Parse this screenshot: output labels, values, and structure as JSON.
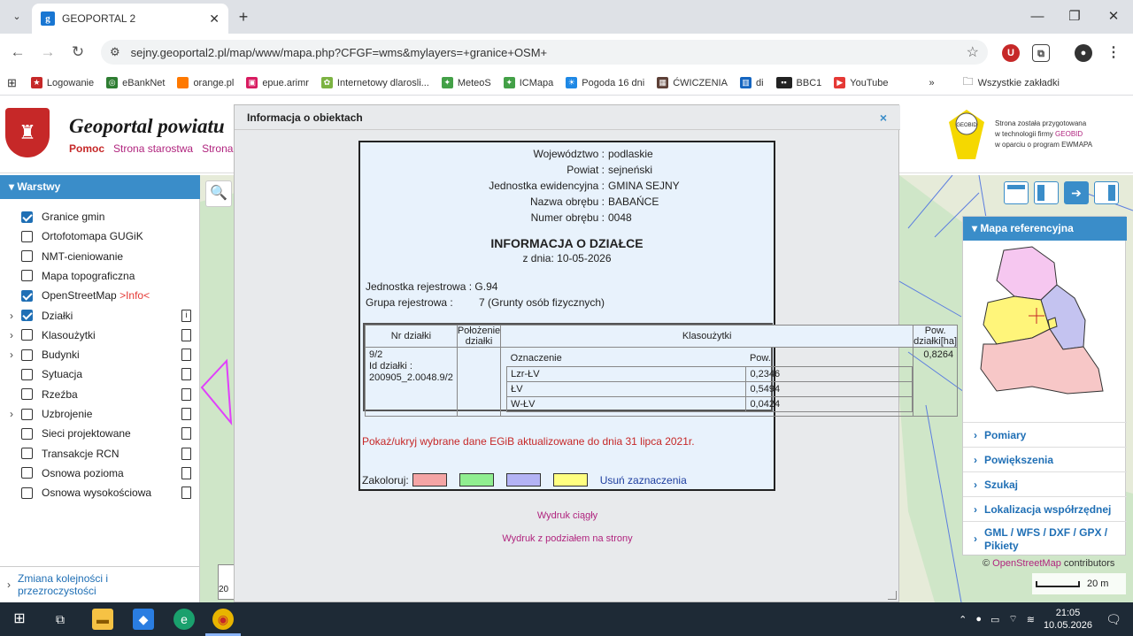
{
  "browser": {
    "tab_title": "GEOPORTAL 2",
    "url": "sejny.geoportal2.pl/map/www/mapa.php?CFGF=wms&mylayers=+granice+OSM+",
    "bookmarks": [
      "Logowanie",
      "eBankNet",
      "orange.pl",
      "epue.arimr",
      "Internetowy dlarosli...",
      "MeteoS",
      "ICMapa",
      "Pogoda 16 dni",
      "ĆWICZENIA",
      "di",
      "BBC1",
      "YouTube"
    ],
    "bookmarks_more": "»",
    "all_bookmarks": "Wszystkie zakładki"
  },
  "header": {
    "title": "Geoportal powiatu",
    "links": [
      "Pomoc",
      "Strona starostwa",
      "Strona"
    ],
    "geobid_line1": "Strona została przygotowana",
    "geobid_line2a": "w technologii firmy ",
    "geobid_brand": "GEOBID",
    "geobid_line3": "w oparciu o program EWMAPA",
    "geobid_logo": "GEOBID"
  },
  "layers_panel": {
    "title": "Warstwy",
    "items": [
      {
        "label": "Granice gmin",
        "checked": true,
        "expandable": false,
        "icon": ""
      },
      {
        "label": "Ortofotomapa GUGiK",
        "checked": false,
        "expandable": false,
        "icon": ""
      },
      {
        "label": "NMT-cieniowanie",
        "checked": false,
        "expandable": false,
        "icon": ""
      },
      {
        "label": "Mapa topograficzna",
        "checked": false,
        "expandable": false,
        "icon": ""
      },
      {
        "label": "OpenStreetMap",
        "suffix": ">Info<",
        "checked": true,
        "expandable": false,
        "icon": ""
      },
      {
        "label": "Działki",
        "checked": true,
        "expandable": true,
        "icon": "doc-info"
      },
      {
        "label": "Klasoużytki",
        "checked": false,
        "expandable": true,
        "icon": "doc"
      },
      {
        "label": "Budynki",
        "checked": false,
        "expandable": true,
        "icon": "doc"
      },
      {
        "label": "Sytuacja",
        "checked": false,
        "expandable": false,
        "icon": "doc"
      },
      {
        "label": "Rzeźba",
        "checked": false,
        "expandable": false,
        "icon": "doc"
      },
      {
        "label": "Uzbrojenie",
        "checked": false,
        "expandable": true,
        "icon": "doc"
      },
      {
        "label": "Sieci projektowane",
        "checked": false,
        "expandable": false,
        "icon": "doc"
      },
      {
        "label": "Transakcje RCN",
        "checked": false,
        "expandable": false,
        "icon": "doc"
      },
      {
        "label": "Osnowa pozioma",
        "checked": false,
        "expandable": false,
        "icon": "doc"
      },
      {
        "label": "Osnowa wysokościowa",
        "checked": false,
        "expandable": false,
        "icon": "doc"
      }
    ],
    "reorder_line1": "Zmiana kolejności i",
    "reorder_line2": "przezroczystości"
  },
  "right_panel": {
    "title": "Mapa referencyjna",
    "items": [
      "Pomiary",
      "Powiększenia",
      "Szukaj",
      "Lokalizacja współrzędnej",
      "GML / WFS / DXF / GPX / Pikiety"
    ]
  },
  "map": {
    "osm_copyright": "© ",
    "osm_link": "OpenStreetMap",
    "osm_suffix": " contributors",
    "scale": "20 m",
    "partial_label": "20"
  },
  "modal": {
    "title": "Informacja o obiektach",
    "close": "×",
    "info": [
      {
        "k": "Województwo",
        "v": "podlaskie"
      },
      {
        "k": "Powiat",
        "v": "sejneński"
      },
      {
        "k": "Jednostka ewidencyjna",
        "v": "GMINA SEJNY"
      },
      {
        "k": "Nazwa obrębu",
        "v": "BABAŃCE"
      },
      {
        "k": "Numer obrębu",
        "v": "0048"
      }
    ],
    "heading": "INFORMACJA O DZIAŁCE",
    "date": "z dnia: 10-05-2026",
    "reg_unit_label": "Jednostka rejestrowa :",
    "reg_unit_value": "G.94",
    "reg_group_label": "Grupa rejestrowa :",
    "reg_group_value": "7 (Grunty osób fizycznych)",
    "table": {
      "headers": [
        "Nr działki",
        "Położenie działki",
        "Klasoużytki",
        "Pow. działki[ha]"
      ],
      "parcel_nr": "9/2",
      "parcel_id_label": "Id działki :",
      "parcel_id": "200905_2.0048.9/2",
      "location": "",
      "sub_headers": [
        "Oznaczenie",
        "Pow."
      ],
      "classes": [
        {
          "code": "Lzr-ŁV",
          "area": "0,2346"
        },
        {
          "code": "ŁV",
          "area": "0,5494"
        },
        {
          "code": "W-ŁV",
          "area": "0,0424"
        }
      ],
      "area_total": "0,8264"
    },
    "egib_note": "Pokaż/ukryj wybrane dane EGiB aktualizowane do dnia 31 lipca 2021r.",
    "color_label": "Zakoloruj:",
    "swatches": [
      "#f4a5a5",
      "#90ee90",
      "#b3b3f5",
      "#ffff80"
    ],
    "remove": "Usuń zaznaczenia",
    "print_cont": "Wydruk ciągły",
    "print_pages": "Wydruk z podziałem na strony"
  },
  "taskbar": {
    "time": "21:05",
    "date": "10.05.2026"
  }
}
